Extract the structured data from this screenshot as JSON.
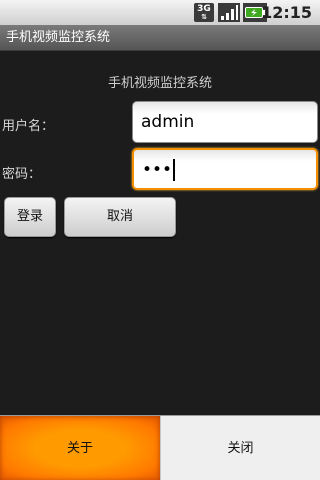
{
  "status_bar": {
    "network_label": "3G",
    "network_arrows": "⇅",
    "time": "12:15",
    "icons": [
      "network-3g-icon",
      "signal-icon",
      "battery-icon"
    ]
  },
  "app": {
    "title": "手机视频监控系统"
  },
  "form": {
    "header": "手机视频监控系统",
    "username_label": "用户名：",
    "username_value": "admin",
    "password_label": "密码：",
    "password_value": "•••"
  },
  "buttons": {
    "login": "登录",
    "cancel": "取消"
  },
  "menu": {
    "about": "关于",
    "close": "关闭"
  },
  "colors": {
    "accent": "#ff8800",
    "background": "#1c1c1c",
    "battery": "#3fa91f"
  }
}
